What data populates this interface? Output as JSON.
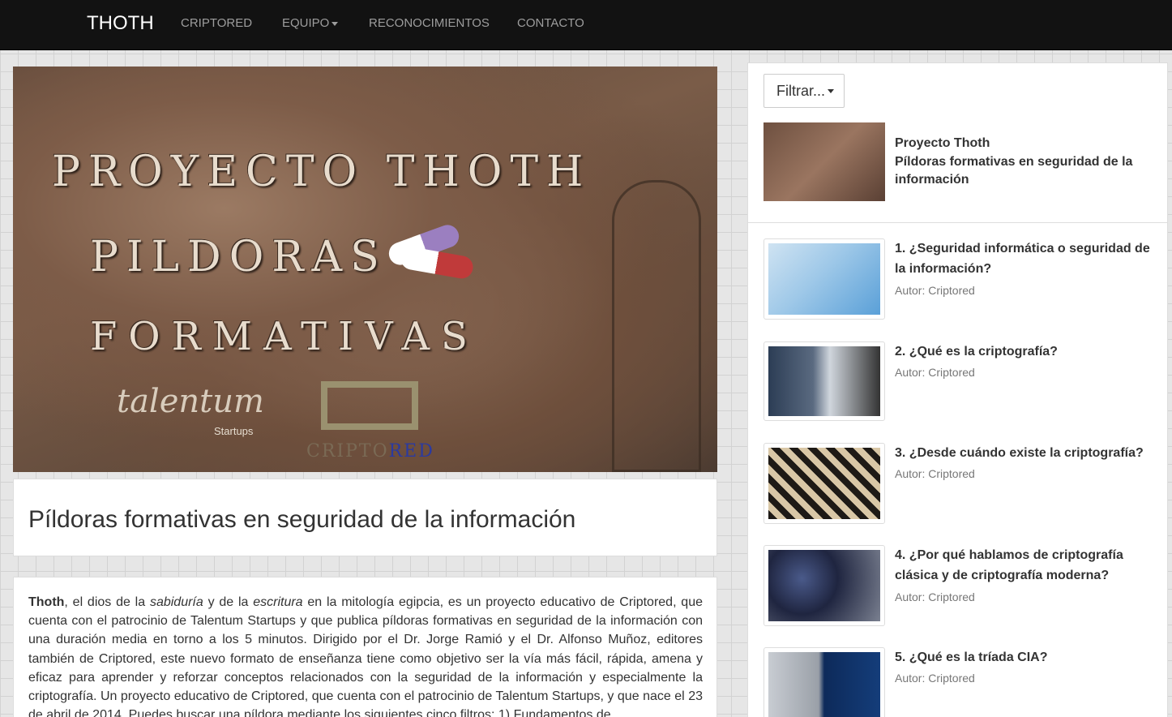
{
  "nav": {
    "brand": "THOTH",
    "items": [
      {
        "label": "CRIPTORED",
        "dropdown": false
      },
      {
        "label": "EQUIPO",
        "dropdown": true
      },
      {
        "label": "RECONOCIMIENTOS",
        "dropdown": false
      },
      {
        "label": "CONTACTO",
        "dropdown": false
      }
    ]
  },
  "hero": {
    "line1": "PROYECTO THOTH",
    "line2": "PILDORAS",
    "line3": "FORMATIVAS",
    "logo_talentum": "talentum",
    "logo_startups": "Startups",
    "logo_cripto": "CRIPTO",
    "logo_red": "RED"
  },
  "main": {
    "title": "Píldoras formativas en seguridad de la información",
    "intro_bold": "Thoth",
    "intro_p1": ", el dios de la ",
    "intro_em1": "sabiduría",
    "intro_p2": " y de la ",
    "intro_em2": "escritura",
    "intro_p3": " en la mitología egipcia, es un proyecto educativo de Criptored, que cuenta con el patrocinio de Talentum Startups y que publica píldoras formativas en seguridad de la información con una duración media en torno a los 5 minutos. Dirigido por el Dr. Jorge Ramió y el Dr. Alfonso Muñoz, editores también de Criptored, este nuevo formato de enseñanza tiene como objetivo ser la vía más fácil, rápida, amena y eficaz para aprender y reforzar conceptos relacionados con la seguridad de la información y especialmente la criptografía. Un proyecto educativo de Criptored, que cuenta con el patrocinio de Talentum Startups, y que nace el 23 de abril de 2014. Puedes buscar una píldora mediante los siguientes cinco filtros: 1) Fundamentos de"
  },
  "sidebar": {
    "filter_label": "Filtrar...",
    "featured": {
      "line1": "Proyecto Thoth",
      "line2": "Píldoras formativas en seguridad de la información"
    },
    "items": [
      {
        "title": "1. ¿Seguridad informática o seguridad de la información?",
        "author": "Autor: Criptored"
      },
      {
        "title": "2. ¿Qué es la criptografía?",
        "author": "Autor: Criptored"
      },
      {
        "title": "3. ¿Desde cuándo existe la criptografía?",
        "author": "Autor: Criptored"
      },
      {
        "title": "4. ¿Por qué hablamos de criptografía clásica y de criptografía moderna?",
        "author": "Autor: Criptored"
      },
      {
        "title": "5. ¿Qué es la tríada CIA?",
        "author": "Autor: Criptored"
      }
    ]
  },
  "colors": {
    "navbar_bg": "#121212",
    "nav_text": "#9d9d9d",
    "brand": "#ffffff"
  }
}
